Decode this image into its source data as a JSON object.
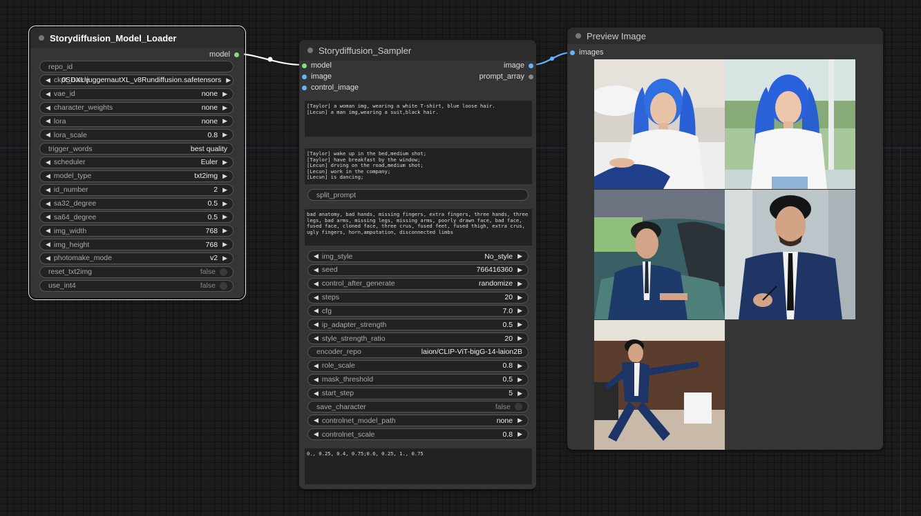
{
  "loader": {
    "title": "Storydiffusion_Model_Loader",
    "output_model": "model",
    "widgets": [
      {
        "label": "repo_id",
        "value": "",
        "kind": "text"
      },
      {
        "label": "ckpt_name",
        "value": "0SDXL\\juggernautXL_v8Rundiffusion.safetensors",
        "kind": "combo"
      },
      {
        "label": "vae_id",
        "value": "none",
        "kind": "combo"
      },
      {
        "label": "character_weights",
        "value": "none",
        "kind": "combo"
      },
      {
        "label": "lora",
        "value": "none",
        "kind": "combo"
      },
      {
        "label": "lora_scale",
        "value": "0.8",
        "kind": "combo"
      },
      {
        "label": "trigger_words",
        "value": "best quality",
        "kind": "text"
      },
      {
        "label": "scheduler",
        "value": "Euler",
        "kind": "combo"
      },
      {
        "label": "model_type",
        "value": "txt2img",
        "kind": "combo"
      },
      {
        "label": "id_number",
        "value": "2",
        "kind": "combo"
      },
      {
        "label": "sa32_degree",
        "value": "0.5",
        "kind": "combo"
      },
      {
        "label": "sa64_degree",
        "value": "0.5",
        "kind": "combo"
      },
      {
        "label": "img_width",
        "value": "768",
        "kind": "combo"
      },
      {
        "label": "img_height",
        "value": "768",
        "kind": "combo"
      },
      {
        "label": "photomake_mode",
        "value": "v2",
        "kind": "combo"
      },
      {
        "label": "reset_txt2img",
        "value": "false",
        "kind": "toggle"
      },
      {
        "label": "use_int4",
        "value": "false",
        "kind": "toggle"
      }
    ]
  },
  "sampler": {
    "title": "Storydiffusion_Sampler",
    "inputs": [
      "model",
      "image",
      "control_image"
    ],
    "outputs": [
      "image",
      "prompt_array"
    ],
    "character_prompt": "[Taylor] a woman img, wearing a white T-shirt, blue loose hair.\n[Lecun] a man img,wearing a suit,black hair.",
    "scene_prompt": "[Taylor] wake up in the bed,medium shot;\n[Taylor] have breakfast by the window;\n[Lecun] drving on the road,medium shot;\n[Lecun] work in the company;\n[Lecun] is dancing;",
    "split_prompt_label": "split_prompt",
    "negative_prompt": "bad anatomy, bad hands, missing fingers, extra fingers, three hands, three legs, bad arms, missing legs, missing arms, poorly drawn face, bad face, fused face, cloned face, three crus, fused feet, fused thigh, extra crus, ugly fingers, horn,amputation, disconnected limbs",
    "widgets": [
      {
        "label": "img_style",
        "value": "No_style",
        "kind": "combo"
      },
      {
        "label": "seed",
        "value": "766416360",
        "kind": "combo"
      },
      {
        "label": "control_after_generate",
        "value": "randomize",
        "kind": "combo"
      },
      {
        "label": "steps",
        "value": "20",
        "kind": "combo"
      },
      {
        "label": "cfg",
        "value": "7.0",
        "kind": "combo"
      },
      {
        "label": "ip_adapter_strength",
        "value": "0.5",
        "kind": "combo"
      },
      {
        "label": "style_strength_ratio",
        "value": "20",
        "kind": "combo"
      },
      {
        "label": "encoder_repo",
        "value": "laion/CLIP-ViT-bigG-14-laion2B",
        "kind": "text"
      },
      {
        "label": "role_scale",
        "value": "0.8",
        "kind": "combo"
      },
      {
        "label": "mask_threshold",
        "value": "0.5",
        "kind": "combo"
      },
      {
        "label": "start_step",
        "value": "5",
        "kind": "combo"
      },
      {
        "label": "save_character",
        "value": "false",
        "kind": "toggle"
      },
      {
        "label": "controlnet_model_path",
        "value": "none",
        "kind": "combo"
      },
      {
        "label": "controlnet_scale",
        "value": "0.8",
        "kind": "combo"
      }
    ],
    "layout_text": "0., 0.25, 0.4, 0.75;0.6, 0.25, 1., 0.75"
  },
  "preview": {
    "title": "Preview Image",
    "input": "images",
    "images": [
      {
        "name": "taylor-bed",
        "hair": "#2f6fe0",
        "shirt": "#f2f2f2",
        "bg": "#dcd6d2"
      },
      {
        "name": "taylor-window",
        "hair": "#2a60d8",
        "shirt": "#f4f4f4",
        "bg": "#9fbf95"
      },
      {
        "name": "lecun-car",
        "suit": "#1d3a6a",
        "bg": "#4f7c77"
      },
      {
        "name": "lecun-office",
        "suit": "#1f3566",
        "bg": "#b9c3c8"
      },
      {
        "name": "lecun-dancing",
        "suit": "#1d3566",
        "bg": "#6a4a36"
      }
    ]
  },
  "colors": {
    "wire_model": "#ffffff",
    "wire_image": "#66b2ff",
    "pin_model": "#7fe07a",
    "pin_image": "#66b2ff"
  }
}
